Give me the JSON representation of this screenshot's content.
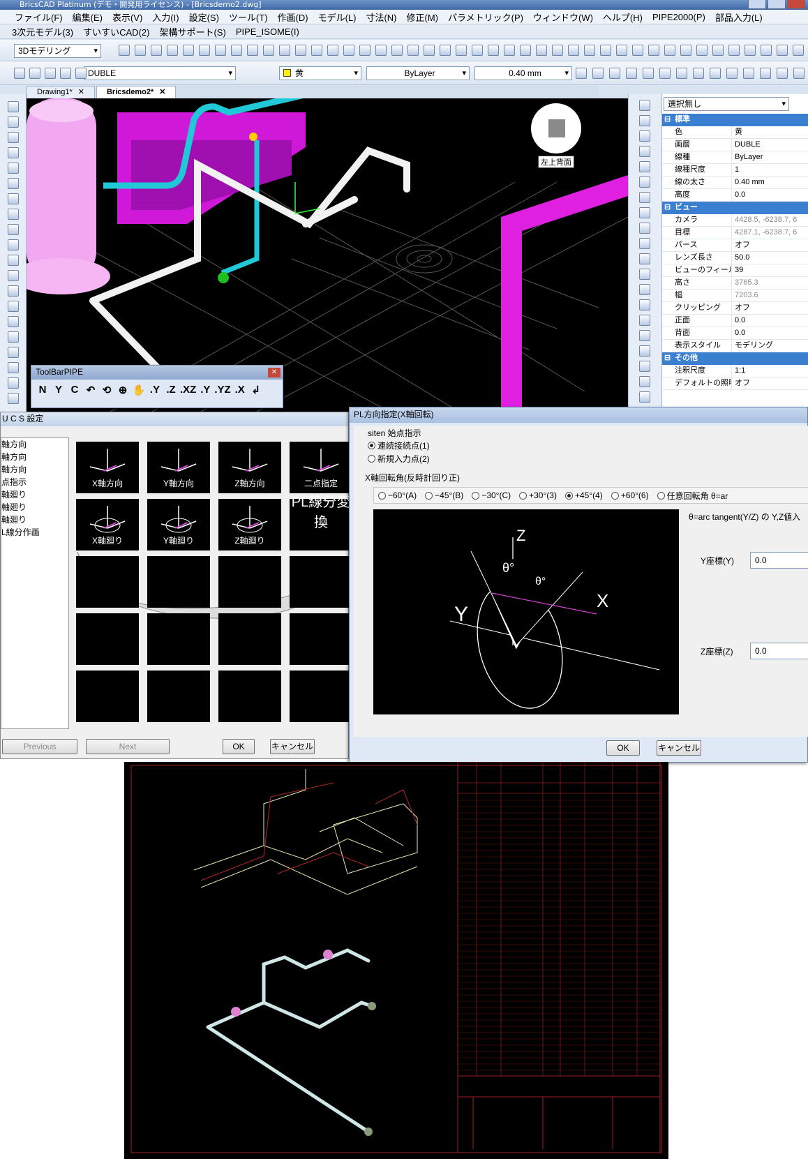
{
  "window": {
    "title": "BricsCAD Platinum (デモ・開発用ライセンス) - [Bricsdemo2.dwg]"
  },
  "menu1": [
    "ファイル(F)",
    "編集(E)",
    "表示(V)",
    "入力(I)",
    "設定(S)",
    "ツール(T)",
    "作画(D)",
    "モデル(L)",
    "寸法(N)",
    "修正(M)",
    "パラメトリック(P)",
    "ウィンドウ(W)",
    "ヘルプ(H)",
    "PIPE2000(P)",
    "部品入力(L)"
  ],
  "menu2": [
    "3次元モデル(3)",
    "すいすいCAD(2)",
    "架構サポート(S)",
    "PIPE_ISOME(I)"
  ],
  "toolbar": {
    "workspace": "3Dモデリング",
    "layer": "DUBLE",
    "color": "黄",
    "linetype": "ByLayer",
    "lineweight": "0.40 mm"
  },
  "tabs": [
    "Drawing1*",
    "Bricsdemo2*"
  ],
  "viewcube": {
    "label": "左上背面"
  },
  "tbpipe": {
    "title": "ToolBarPIPE",
    "buttons": [
      "N",
      "Y",
      "C",
      "↶",
      "⟲",
      "⊕",
      "✋",
      ".Y",
      ".Z",
      ".XZ",
      ".Y",
      ".YZ",
      ".X",
      "↲"
    ]
  },
  "props": {
    "selector": "選択無し",
    "sections": [
      {
        "title": "標準",
        "rows": [
          {
            "k": "色",
            "v": "黄"
          },
          {
            "k": "画層",
            "v": "DUBLE"
          },
          {
            "k": "線種",
            "v": "ByLayer"
          },
          {
            "k": "線種尺度",
            "v": "1"
          },
          {
            "k": "線の太さ",
            "v": "0.40 mm"
          },
          {
            "k": "高度",
            "v": "0.0"
          }
        ]
      },
      {
        "title": "ビュー",
        "rows": [
          {
            "k": "カメラ",
            "v": "4428.5, -6238.7, 6"
          },
          {
            "k": "目標",
            "v": "4287.1, -6238.7, 6"
          },
          {
            "k": "パース",
            "v": "オフ"
          },
          {
            "k": "レンズ長さ",
            "v": "50.0"
          },
          {
            "k": "ビューのフィールド",
            "v": "39"
          },
          {
            "k": "高さ",
            "v": "3765.3"
          },
          {
            "k": "幅",
            "v": "7203.6"
          },
          {
            "k": "クリッピング",
            "v": "オフ"
          },
          {
            "k": "正面",
            "v": "0.0"
          },
          {
            "k": "背面",
            "v": "0.0"
          },
          {
            "k": "表示スタイル",
            "v": "モデリング"
          }
        ]
      },
      {
        "title": "その他",
        "rows": [
          {
            "k": "注釈尺度",
            "v": "1:1"
          },
          {
            "k": "デフォルトの照明",
            "v": "オフ"
          }
        ]
      }
    ]
  },
  "ucs": {
    "title": "U C S 設定",
    "list": [
      "軸方向",
      "軸方向",
      "軸方向",
      "点指示",
      "軸廻り",
      "軸廻り",
      "軸廻り",
      "L線分作画"
    ],
    "tiles": [
      "X軸方向",
      "Y軸方向",
      "Z軸方向",
      "二点指定",
      "X軸廻り",
      "Y軸廻り",
      "Z軸廻り",
      "PL線分変換"
    ],
    "previous": "Previous",
    "next": "Next",
    "ok": "OK",
    "cancel": "キャンセル"
  },
  "pl": {
    "title": "PL方向指定(X軸回転)",
    "start_label": "siten 始点指示",
    "opt1": "連続接続点(1)",
    "opt2": "新規入力点(2)",
    "rot_label": "X軸回転角(反時計回り正)",
    "angles": [
      "−60°(A)",
      "−45°(B)",
      "−30°(C)",
      "+30°(3)",
      "+45°(4)",
      "+60°(6)",
      "任意回転角 θ=ar"
    ],
    "selected_angle": 4,
    "formula": "θ=arc tangent(Y/Z) の Y,Z値入",
    "y_label": "Y座標(Y)",
    "y_value": "0.0",
    "z_label": "Z座標(Z)",
    "z_value": "0.0",
    "ok": "OK",
    "cancel": "キャンセル"
  },
  "colors": {
    "magenta": "#e020e0",
    "cyan": "#20c8d8",
    "pipe": "#f2f2f2",
    "accent": "#3a7fd0"
  }
}
